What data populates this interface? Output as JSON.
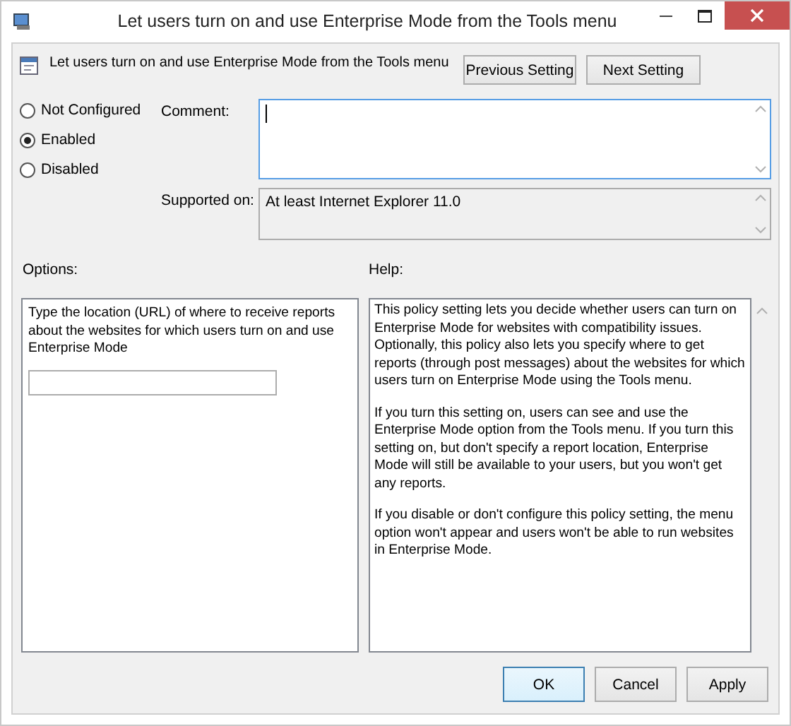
{
  "window": {
    "title": "Let users turn on and use Enterprise Mode from the Tools menu"
  },
  "header": {
    "setting_name": "Let users turn on and use Enterprise Mode from the Tools menu",
    "buttons": [
      "Previous Setting",
      "Next Setting"
    ]
  },
  "states": [
    {
      "label": "Not Configured",
      "selected": false
    },
    {
      "label": "Enabled",
      "selected": true
    },
    {
      "label": "Disabled",
      "selected": false
    }
  ],
  "comment": {
    "label": "Comment:"
  },
  "supported_on": {
    "label": "Supported on:",
    "value": "At least Internet Explorer 11.0"
  },
  "options": {
    "label": "Options:",
    "description": "Type the location (URL) of where to receive reports about the websites for which users turn on and use Enterprise Mode"
  },
  "help": {
    "label": "Help:",
    "paragraphs": [
      "This policy setting lets you decide whether users can turn on Enterprise Mode for websites with compatibility issues. Optionally, this policy also lets you specify where to get reports (through post messages) about the websites for which users turn on Enterprise Mode using the Tools menu.",
      "If you turn this setting on, users can see and use the Enterprise Mode option from the Tools menu. If you turn this setting on, but don't specify a report location, Enterprise Mode will still be available to your users, but you won't get any reports.",
      "If you disable or don't configure this policy setting, the menu option won't appear and users won't be able to run websites in Enterprise Mode."
    ]
  },
  "footer_buttons": [
    {
      "label": "OK",
      "highlighted": true
    },
    {
      "label": "Cancel",
      "highlighted": false
    },
    {
      "label": "Apply",
      "highlighted": false
    }
  ]
}
